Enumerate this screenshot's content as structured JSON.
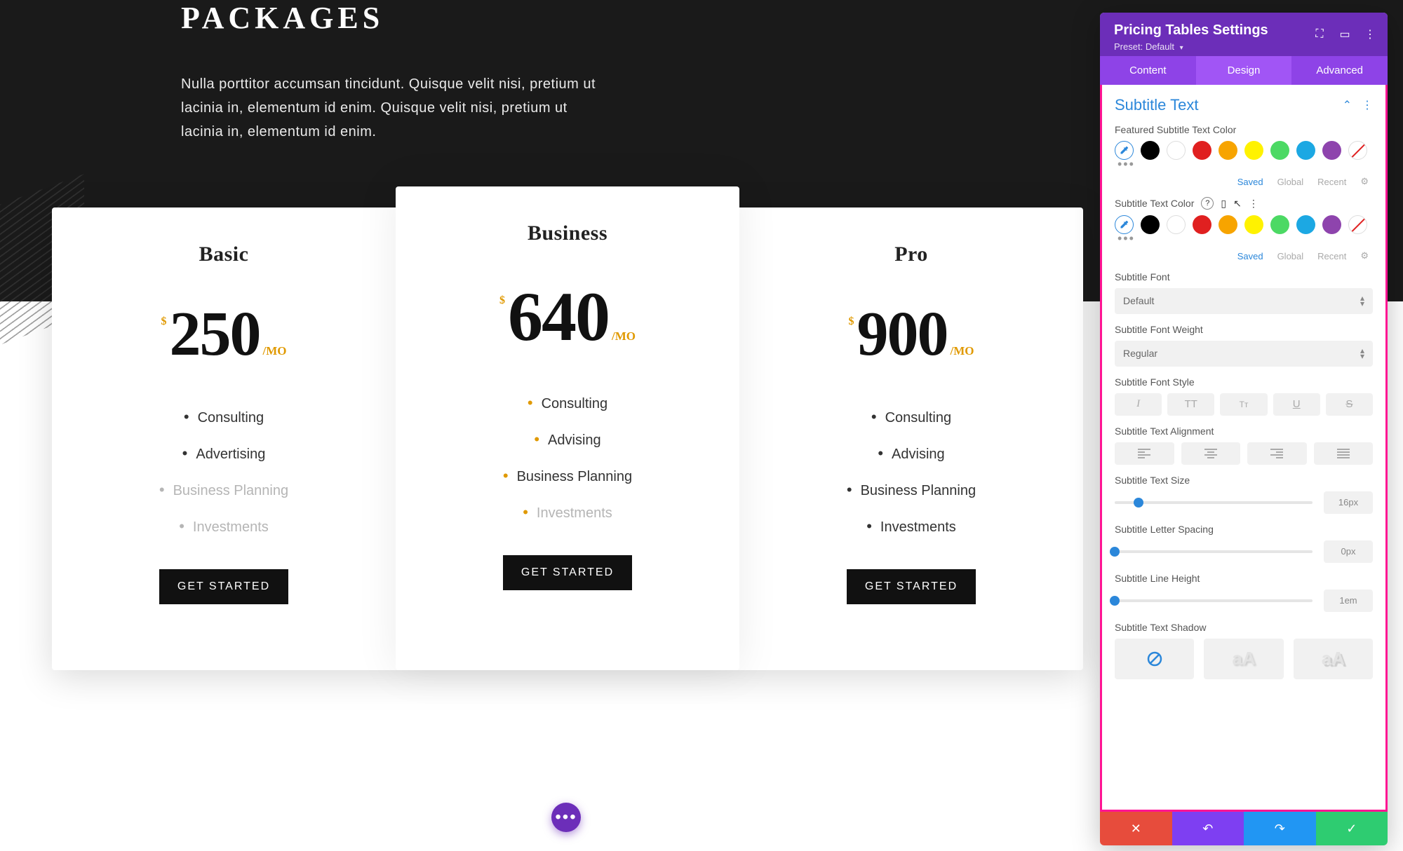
{
  "hero": {
    "title": "PACKAGES",
    "desc": "Nulla porttitor accumsan tincidunt. Quisque velit nisi, pretium ut lacinia in, elementum id enim. Quisque velit nisi, pretium ut lacinia in, elementum id enim."
  },
  "pricing": {
    "cta": "GET STARTED",
    "period": "/MO",
    "currency": "$",
    "plans": [
      {
        "name": "Basic",
        "price": "250",
        "features": [
          "Consulting",
          "Advertising",
          "Business Planning",
          "Investments"
        ],
        "muted_from": 2
      },
      {
        "name": "Business",
        "price": "640",
        "featured": true,
        "features": [
          "Consulting",
          "Advising",
          "Business Planning",
          "Investments"
        ],
        "muted_from": 3
      },
      {
        "name": "Pro",
        "price": "900",
        "features": [
          "Consulting",
          "Advising",
          "Business Planning",
          "Investments"
        ],
        "muted_from": 99
      }
    ]
  },
  "panel": {
    "title": "Pricing Tables Settings",
    "preset_label": "Preset:",
    "preset_value": "Default",
    "tabs": [
      "Content",
      "Design",
      "Advanced"
    ],
    "active_tab": 1,
    "section": "Subtitle Text",
    "labels": {
      "featured_color": "Featured Subtitle Text Color",
      "color": "Subtitle Text Color",
      "font": "Subtitle Font",
      "weight": "Subtitle Font Weight",
      "style": "Subtitle Font Style",
      "align": "Subtitle Text Alignment",
      "size": "Subtitle Text Size",
      "spacing": "Subtitle Letter Spacing",
      "line_height": "Subtitle Line Height",
      "shadow": "Subtitle Text Shadow"
    },
    "color_tabs": [
      "Saved",
      "Global",
      "Recent"
    ],
    "color_tab_active": 0,
    "swatches": [
      "#000000",
      "#ffffff",
      "#e02020",
      "#f7a400",
      "#fff200",
      "#4cd964",
      "#1ca8e3",
      "#8e44ad"
    ],
    "font_value": "Default",
    "weight_value": "Regular",
    "style_buttons": [
      "italic",
      "uppercase",
      "smallcaps",
      "underline",
      "strikethrough"
    ],
    "size_value": "16px",
    "size_pos": 12,
    "spacing_value": "0px",
    "spacing_pos": 0,
    "line_height_value": "1em",
    "line_height_pos": 0,
    "shadow_text": "aA"
  }
}
